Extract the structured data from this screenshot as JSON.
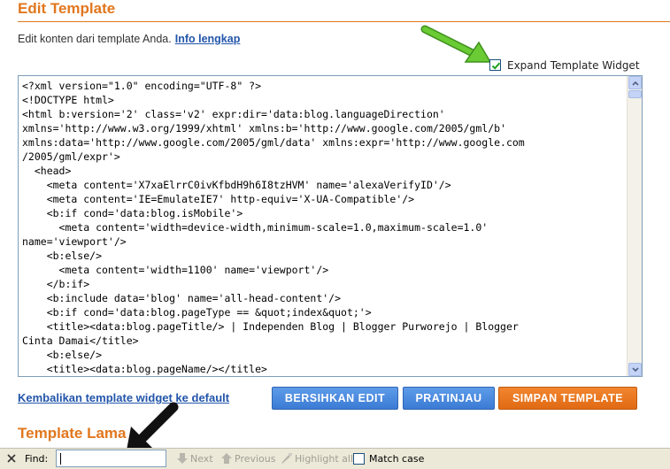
{
  "header": {
    "title": "Edit Template",
    "description": "Edit konten dari template Anda.",
    "info_link": "Info lengkap"
  },
  "expand_widget": {
    "label": "Expand Template Widget",
    "checked": true
  },
  "editor": {
    "lines": [
      "<?xml version=\"1.0\" encoding=\"UTF-8\" ?>",
      "<!DOCTYPE html>",
      "<html b:version='2' class='v2' expr:dir='data:blog.languageDirection'",
      "xmlns='http://www.w3.org/1999/xhtml' xmlns:b='http://www.google.com/2005/gml/b'",
      "xmlns:data='http://www.google.com/2005/gml/data' xmlns:expr='http://www.google.com",
      "/2005/gml/expr'>",
      "  <head>",
      "    <meta content='X7xaElrrC0ivKfbdH9h6I8tzHVM' name='alexaVerifyID'/>",
      "    <meta content='IE=EmulateIE7' http-equiv='X-UA-Compatible'/>",
      "    <b:if cond='data:blog.isMobile'>",
      "      <meta content='width=device-width,minimum-scale=1.0,maximum-scale=1.0'",
      "name='viewport'/>",
      "    <b:else/>",
      "      <meta content='width=1100' name='viewport'/>",
      "    </b:if>",
      "    <b:include data='blog' name='all-head-content'/>",
      "    <b:if cond='data:blog.pageType == &quot;index&quot;'>",
      "    <title><data:blog.pageTitle/> | Independen Blog | Blogger Purworejo | Blogger",
      "Cinta Damai</title>",
      "    <b:else/>",
      "    <title><data:blog.pageName/></title>"
    ]
  },
  "actions": {
    "restore_link": "Kembalikan template widget ke default",
    "clear_button": "BERSIHKAN EDIT",
    "preview_button": "PRATINJAU",
    "save_button": "SIMPAN TEMPLATE"
  },
  "old_template": {
    "title": "Template Lama"
  },
  "find_bar": {
    "label": "Find:",
    "input_value": "",
    "next": "Next",
    "previous": "Previous",
    "highlight_all": "Highlight all",
    "match_case": "Match case",
    "match_case_checked": false
  },
  "colors": {
    "accent_orange": "#e1771e",
    "link_blue": "#2255aa",
    "button_blue": "#3b7bd4",
    "button_orange": "#e06a14",
    "annotation_green": "#5fbf2a"
  },
  "icons": {
    "annotation_arrow_green": "green-arrow-icon",
    "annotation_arrow_black": "black-arrow-icon",
    "close": "close-icon"
  }
}
